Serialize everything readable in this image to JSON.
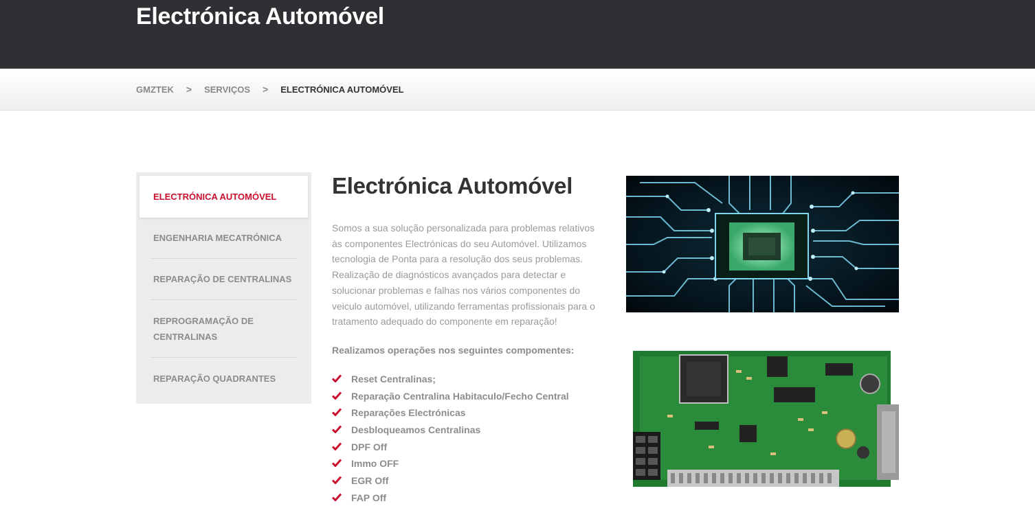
{
  "header": {
    "title": "Electrónica Automóvel"
  },
  "breadcrumb": {
    "items": [
      "GMZTEK",
      "SERVIÇOS"
    ],
    "separator": ">",
    "current": "ELECTRÓNICA AUTOMÓVEL"
  },
  "sidebar": {
    "items": [
      {
        "label": "ELECTRÓNICA AUTOMÓVEL"
      },
      {
        "label": "ENGENHARIA MECATRÓNICA"
      },
      {
        "label": "REPARAÇÃO DE CENTRALINAS"
      },
      {
        "label": "REPROGRAMAÇÃO DE CENTRALINAS"
      },
      {
        "label": "REPARAÇÃO QUADRANTES"
      }
    ]
  },
  "content": {
    "heading": "Electrónica Automóvel",
    "description": "Somos a sua solução personalizada para problemas relativos às componentes Electrónicas do seu Automóvel. Utilizamos tecnologia de Ponta para a resolução dos seus problemas. Realização de diagnósticos avançados para detectar e solucionar problemas e falhas nos vários componentes do veiculo automóvel, utilizando ferramentas profissionais para o tratamento adequado do componente em reparação!",
    "ops_title": "Realizamos operações nos seguintes compomentes:",
    "ops": [
      "Reset Centralinas;",
      "Reparação Centralina Habitaculo/Fecho Central",
      "Reparações Electrónicas",
      "Desbloqueamos Centralinas",
      "DPF Off",
      "Immo OFF",
      "EGR Off",
      "FAP Off"
    ]
  },
  "colors": {
    "topbar": "#2f3033",
    "accent": "#c8102e",
    "sidebar_bg": "#ececec",
    "muted_text": "#8c8c8c"
  },
  "images": {
    "top": "circuit-board-chip-photo",
    "bottom": "ecu-pcb-photo"
  }
}
